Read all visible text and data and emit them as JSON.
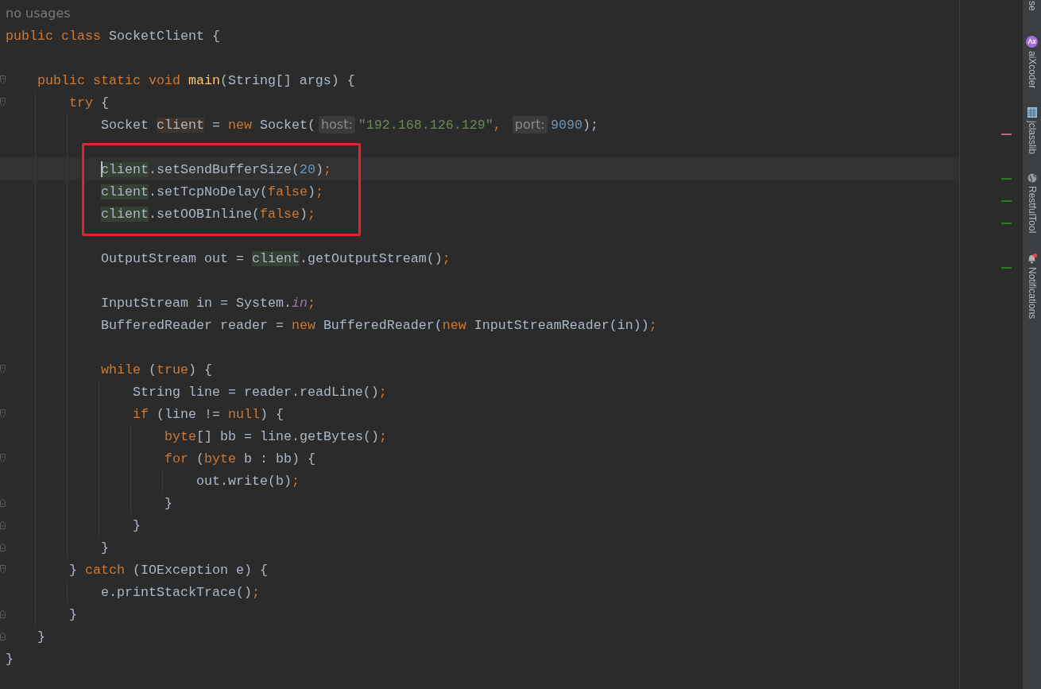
{
  "editor": {
    "lines": [
      {
        "kind": "code-vision",
        "text": "no usages"
      },
      {
        "kind": "code",
        "tokens": [
          {
            "kind": "kw",
            "text": "public class "
          },
          {
            "kind": "plain",
            "text": "SocketClient {"
          }
        ],
        "children": [
          {
            "kind": "blank"
          },
          {
            "kind": "code",
            "fold_start": true,
            "tokens": [
              {
                "kind": "kw",
                "text": "public static void "
              },
              {
                "kind": "decl",
                "text": "main"
              },
              {
                "kind": "plain",
                "text": "(String[] args) {"
              }
            ],
            "children": [
              {
                "kind": "code",
                "fold_start": true,
                "tokens": [
                  {
                    "kind": "kw",
                    "text": "try "
                  },
                  {
                    "kind": "plain",
                    "text": "{"
                  }
                ],
                "children": [
                  {
                    "kind": "code",
                    "color": "#b8687a",
                    "tokens": [
                      {
                        "kind": "plain",
                        "text": "Socket "
                      },
                      {
                        "kind": "write",
                        "text": "client"
                      },
                      {
                        "kind": "plain",
                        "text": " = "
                      },
                      {
                        "kind": "kw",
                        "text": "new "
                      },
                      {
                        "kind": "plain",
                        "text": "Socket("
                      },
                      {
                        "kind": "hint",
                        "text": "host:"
                      },
                      {
                        "kind": "str",
                        "text": "\"192.168.126.129\""
                      },
                      {
                        "kind": "kw",
                        "text": ", "
                      },
                      {
                        "kind": "hint",
                        "text": "port:"
                      },
                      {
                        "kind": "num",
                        "text": "9090"
                      },
                      {
                        "kind": "plain",
                        "text": ");"
                      }
                    ]
                  },
                  {
                    "kind": "blank",
                    "boxed": true
                  },
                  {
                    "kind": "code",
                    "boxed": true,
                    "current": true,
                    "color": "#287b28",
                    "tokens": [
                      {
                        "kind": "read",
                        "text": "client"
                      },
                      {
                        "kind": "plain",
                        "text": ".setSendBufferSize("
                      },
                      {
                        "kind": "num",
                        "text": "20"
                      },
                      {
                        "kind": "plain",
                        "text": ")"
                      },
                      {
                        "kind": "kw",
                        "text": ";"
                      }
                    ]
                  },
                  {
                    "kind": "code",
                    "boxed": true,
                    "color": "#287b28",
                    "tokens": [
                      {
                        "kind": "read",
                        "text": "client"
                      },
                      {
                        "kind": "plain",
                        "text": ".setTcpNoDelay("
                      },
                      {
                        "kind": "kw",
                        "text": "false"
                      },
                      {
                        "kind": "plain",
                        "text": ")"
                      },
                      {
                        "kind": "kw",
                        "text": ";"
                      }
                    ]
                  },
                  {
                    "kind": "code",
                    "boxed": true,
                    "color": "#287b28",
                    "tokens": [
                      {
                        "kind": "read",
                        "text": "client"
                      },
                      {
                        "kind": "plain",
                        "text": ".setOOBInline("
                      },
                      {
                        "kind": "kw",
                        "text": "false"
                      },
                      {
                        "kind": "plain",
                        "text": ")"
                      },
                      {
                        "kind": "kw",
                        "text": ";"
                      }
                    ]
                  },
                  {
                    "kind": "blank"
                  },
                  {
                    "kind": "code",
                    "color": "#287b28",
                    "tokens": [
                      {
                        "kind": "plain",
                        "text": "OutputStream out = "
                      },
                      {
                        "kind": "read",
                        "text": "client"
                      },
                      {
                        "kind": "plain",
                        "text": ".getOutputStream()"
                      },
                      {
                        "kind": "kw",
                        "text": ";"
                      }
                    ]
                  },
                  {
                    "kind": "blank"
                  },
                  {
                    "kind": "code",
                    "tokens": [
                      {
                        "kind": "plain",
                        "text": "InputStream in = System."
                      },
                      {
                        "kind": "static",
                        "text": "in"
                      },
                      {
                        "kind": "kw",
                        "text": ";"
                      }
                    ]
                  },
                  {
                    "kind": "code",
                    "tokens": [
                      {
                        "kind": "plain",
                        "text": "BufferedReader reader = "
                      },
                      {
                        "kind": "kw",
                        "text": "new "
                      },
                      {
                        "kind": "plain",
                        "text": "BufferedReader("
                      },
                      {
                        "kind": "kw",
                        "text": "new "
                      },
                      {
                        "kind": "plain",
                        "text": "InputStreamReader(in))"
                      },
                      {
                        "kind": "kw",
                        "text": ";"
                      }
                    ]
                  },
                  {
                    "kind": "blank"
                  },
                  {
                    "kind": "code",
                    "fold_start": true,
                    "tokens": [
                      {
                        "kind": "kw",
                        "text": "while "
                      },
                      {
                        "kind": "plain",
                        "text": "("
                      },
                      {
                        "kind": "kw",
                        "text": "true"
                      },
                      {
                        "kind": "plain",
                        "text": ") {"
                      }
                    ],
                    "children": [
                      {
                        "kind": "code",
                        "tokens": [
                          {
                            "kind": "plain",
                            "text": "String line = reader.readLine()"
                          },
                          {
                            "kind": "kw",
                            "text": ";"
                          }
                        ]
                      },
                      {
                        "kind": "code",
                        "fold_start": true,
                        "tokens": [
                          {
                            "kind": "kw",
                            "text": "if "
                          },
                          {
                            "kind": "plain",
                            "text": "(line != "
                          },
                          {
                            "kind": "kw",
                            "text": "null"
                          },
                          {
                            "kind": "plain",
                            "text": ") {"
                          }
                        ],
                        "children": [
                          {
                            "kind": "code",
                            "tokens": [
                              {
                                "kind": "kw",
                                "text": "byte"
                              },
                              {
                                "kind": "plain",
                                "text": "[] bb = line.getBytes()"
                              },
                              {
                                "kind": "kw",
                                "text": ";"
                              }
                            ]
                          },
                          {
                            "kind": "code",
                            "fold_start": true,
                            "tokens": [
                              {
                                "kind": "kw",
                                "text": "for "
                              },
                              {
                                "kind": "plain",
                                "text": "("
                              },
                              {
                                "kind": "kw",
                                "text": "byte "
                              },
                              {
                                "kind": "plain",
                                "text": "b : bb) {"
                              }
                            ],
                            "children": [
                              {
                                "kind": "code",
                                "tokens": [
                                  {
                                    "kind": "plain",
                                    "text": "out.write(b)"
                                  },
                                  {
                                    "kind": "kw",
                                    "text": ";"
                                  }
                                ]
                              }
                            ]
                          },
                          {
                            "kind": "code",
                            "fold_end": true,
                            "tokens": [
                              {
                                "kind": "plain",
                                "text": "}"
                              }
                            ]
                          }
                        ]
                      },
                      {
                        "kind": "code",
                        "fold_end": true,
                        "tokens": [
                          {
                            "kind": "plain",
                            "text": "}"
                          }
                        ]
                      }
                    ]
                  },
                  {
                    "kind": "code",
                    "fold_end": true,
                    "tokens": [
                      {
                        "kind": "plain",
                        "text": "}"
                      }
                    ]
                  }
                ]
              },
              {
                "kind": "code",
                "fold_start": true,
                "tokens": [
                  {
                    "kind": "plain",
                    "text": "} "
                  },
                  {
                    "kind": "kw",
                    "text": "catch "
                  },
                  {
                    "kind": "plain",
                    "text": "(IOException e) {"
                  }
                ],
                "children": [
                  {
                    "kind": "code",
                    "tokens": [
                      {
                        "kind": "plain",
                        "text": "e.printStackTrace()"
                      },
                      {
                        "kind": "kw",
                        "text": ";"
                      }
                    ]
                  }
                ]
              },
              {
                "kind": "code",
                "fold_end": true,
                "tokens": [
                  {
                    "kind": "plain",
                    "text": "}"
                  }
                ]
              }
            ]
          },
          {
            "kind": "code",
            "fold_end": true,
            "tokens": [
              {
                "kind": "plain",
                "text": "}"
              }
            ]
          }
        ]
      },
      {
        "kind": "code",
        "tokens": [
          {
            "kind": "plain",
            "text": "}"
          }
        ]
      }
    ]
  },
  "tool_strip": [
    {
      "kind": "cut",
      "label": "se"
    },
    {
      "kind": "aix",
      "label": "aiXcoder"
    },
    {
      "kind": "grid",
      "label": "jclasslib"
    },
    {
      "kind": "globe",
      "label": "RestfulTool"
    },
    {
      "kind": "bell",
      "label": "Notifications",
      "badge": true
    }
  ]
}
